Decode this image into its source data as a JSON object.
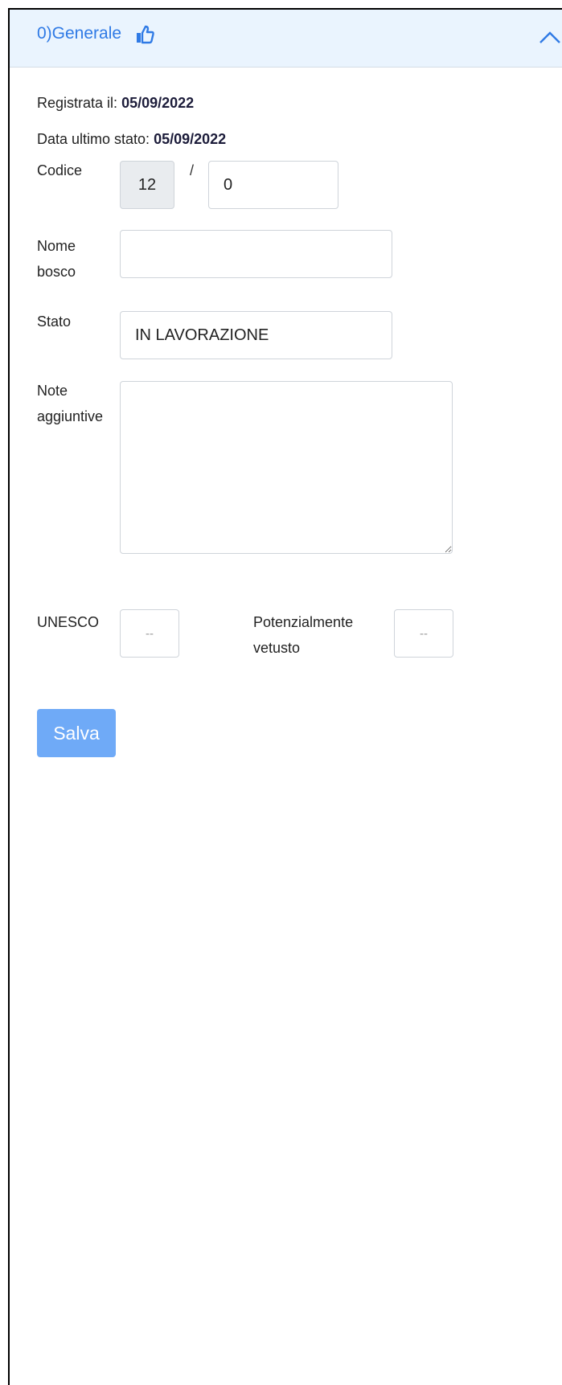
{
  "header": {
    "title": "0)Generale"
  },
  "info": {
    "registered_label": "Registrata il:",
    "registered_value": "05/09/2022",
    "last_state_label": "Data ultimo stato:",
    "last_state_value": "05/09/2022"
  },
  "form": {
    "codice": {
      "label": "Codice",
      "prefix_value": "12",
      "separator": "/",
      "suffix_value": "0"
    },
    "nome_bosco": {
      "label_line1": "Nome",
      "label_line2": "bosco",
      "value": ""
    },
    "stato": {
      "label": "Stato",
      "value": "IN LAVORAZIONE"
    },
    "note": {
      "label_line1": "Note",
      "label_line2": "aggiuntive",
      "value": ""
    },
    "unesco": {
      "label": "UNESCO",
      "value": "--"
    },
    "vetusto": {
      "label_line1": "Potenzialmente",
      "label_line2": "vetusto",
      "value": "--"
    }
  },
  "actions": {
    "save_label": "Salva"
  },
  "colors": {
    "accent": "#2f7ae5",
    "header_bg": "#eaf4fe",
    "save_button": "#6faaf7"
  },
  "icons": {
    "like": "thumbs-up-icon",
    "collapse": "chevron-up-icon"
  }
}
